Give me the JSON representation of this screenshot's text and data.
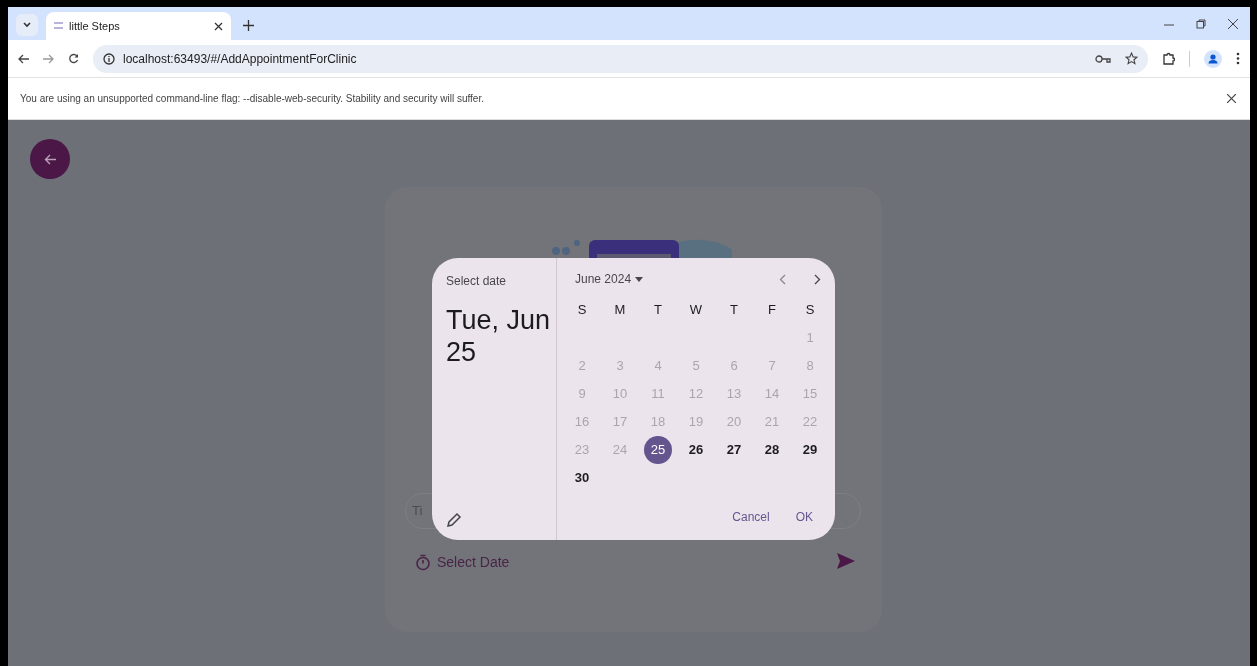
{
  "browser": {
    "tab_title": "little Steps",
    "url": "localhost:63493/#/AddAppointmentForClinic",
    "infobar": "You are using an unsupported command-line flag: --disable-web-security. Stability and security will suffer."
  },
  "page": {
    "field": {
      "placeholder": "Ti"
    },
    "date_link": "Select Date"
  },
  "date_picker": {
    "title": "Select date",
    "headline": "Tue, Jun 25",
    "month": "June 2024",
    "weekdays": [
      "S",
      "M",
      "T",
      "W",
      "T",
      "F",
      "S"
    ],
    "weeks": [
      {
        "days": [
          {
            "label": "1",
            "disabled": true,
            "selected": false
          }
        ]
      },
      {
        "days": [
          {
            "label": "2",
            "disabled": true,
            "selected": false
          },
          {
            "label": "3",
            "disabled": true,
            "selected": false
          },
          {
            "label": "4",
            "disabled": true,
            "selected": false
          },
          {
            "label": "5",
            "disabled": true,
            "selected": false
          },
          {
            "label": "6",
            "disabled": true,
            "selected": false
          },
          {
            "label": "7",
            "disabled": true,
            "selected": false
          },
          {
            "label": "8",
            "disabled": true,
            "selected": false
          }
        ]
      },
      {
        "days": [
          {
            "label": "9",
            "disabled": true,
            "selected": false
          },
          {
            "label": "10",
            "disabled": true,
            "selected": false
          },
          {
            "label": "11",
            "disabled": true,
            "selected": false
          },
          {
            "label": "12",
            "disabled": true,
            "selected": false
          },
          {
            "label": "13",
            "disabled": true,
            "selected": false
          },
          {
            "label": "14",
            "disabled": true,
            "selected": false
          },
          {
            "label": "15",
            "disabled": true,
            "selected": false
          }
        ]
      },
      {
        "days": [
          {
            "label": "16",
            "disabled": true,
            "selected": false
          },
          {
            "label": "17",
            "disabled": true,
            "selected": false
          },
          {
            "label": "18",
            "disabled": true,
            "selected": false
          },
          {
            "label": "19",
            "disabled": true,
            "selected": false
          },
          {
            "label": "20",
            "disabled": true,
            "selected": false
          },
          {
            "label": "21",
            "disabled": true,
            "selected": false
          },
          {
            "label": "22",
            "disabled": true,
            "selected": false
          }
        ]
      },
      {
        "days": [
          {
            "label": "23",
            "disabled": true,
            "selected": false
          },
          {
            "label": "24",
            "disabled": true,
            "selected": false
          },
          {
            "label": "25",
            "disabled": false,
            "selected": true
          },
          {
            "label": "26",
            "disabled": false,
            "selected": false
          },
          {
            "label": "27",
            "disabled": false,
            "selected": false
          },
          {
            "label": "28",
            "disabled": false,
            "selected": false
          },
          {
            "label": "29",
            "disabled": false,
            "selected": false
          }
        ]
      },
      {
        "days": [
          {
            "label": "30",
            "disabled": false,
            "selected": false
          }
        ]
      }
    ],
    "buttons": [
      "Cancel",
      "OK"
    ]
  }
}
